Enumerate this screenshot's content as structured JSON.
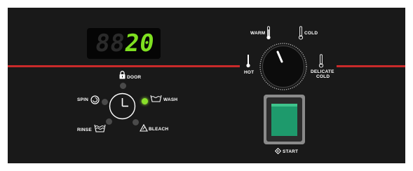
{
  "display": {
    "digits": [
      "8",
      "8",
      "2",
      "0"
    ],
    "lit_value": "20",
    "color": "#7ee020"
  },
  "indicators": {
    "door": {
      "label": "DOOR",
      "icon": "lock-icon",
      "active": false
    },
    "spin": {
      "label": "SPIN",
      "icon": "spin-icon",
      "active": false
    },
    "wash": {
      "label": "WASH",
      "icon": "wash-tub-icon",
      "active": true
    },
    "rinse": {
      "label": "RINSE",
      "icon": "rinse-tub-icon",
      "active": false
    },
    "bleach": {
      "label": "BLEACH",
      "icon": "bleach-triangle-icon",
      "active": false
    },
    "center_icon": "clock-icon"
  },
  "temperature_dial": {
    "options": {
      "hot": "HOT",
      "warm": "WARM",
      "cold": "COLD",
      "delicate_line1": "DELICATE",
      "delicate_line2": "COLD"
    },
    "icon": "thermometer-icon"
  },
  "start": {
    "label": "START",
    "icon": "start-diamond-icon",
    "button_color": "#1e9a6c"
  },
  "colors": {
    "panel": "#191919",
    "stripe": "#c92a2a",
    "indicator_active": "#8ae02a",
    "indicator_inactive": "#4a4a4a"
  }
}
